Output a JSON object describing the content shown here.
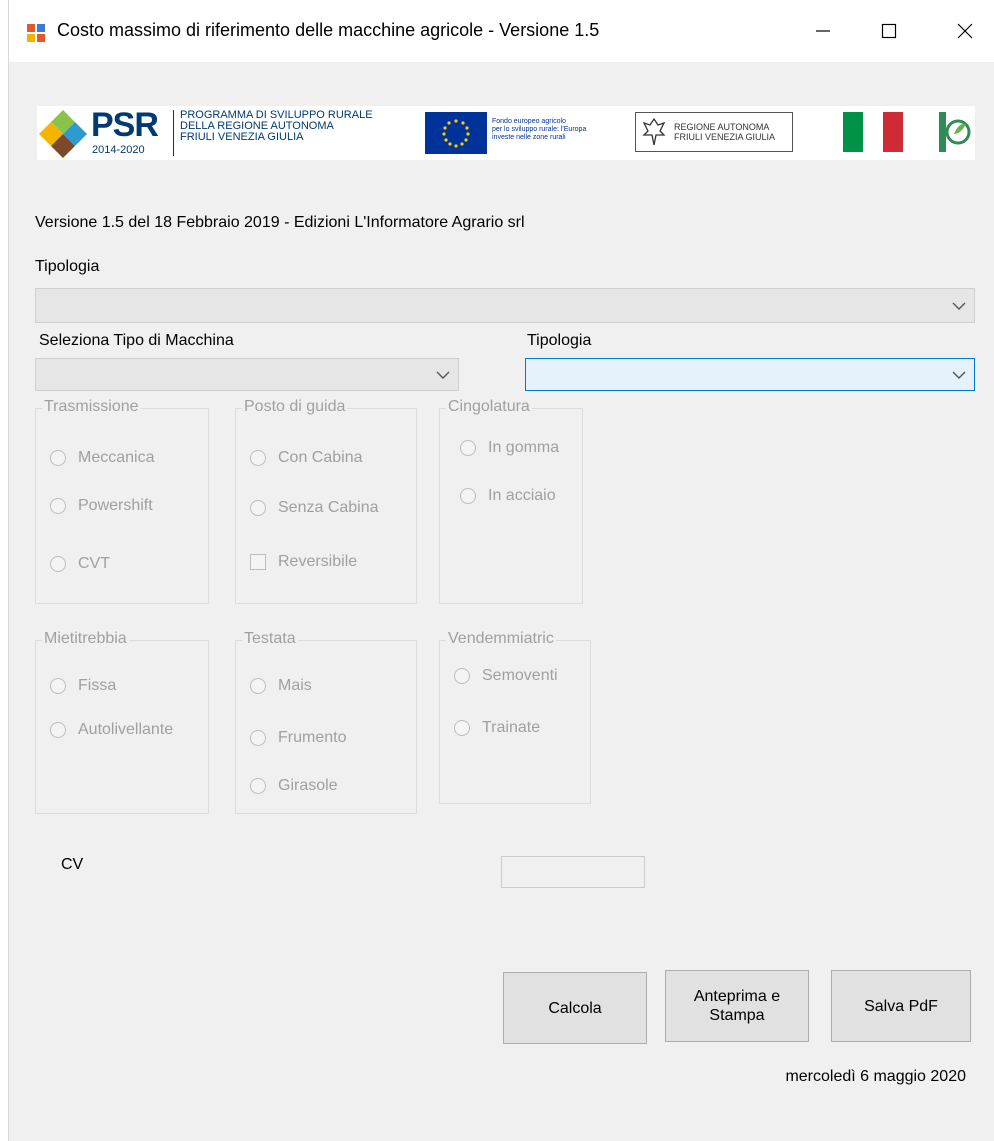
{
  "window": {
    "title": "Costo massimo di riferimento delle macchine agricole - Versione 1.5",
    "controls": [
      "minimize-icon",
      "maximize-icon",
      "close-icon"
    ]
  },
  "banner": {
    "psr": {
      "name": "PSR",
      "years": "2014-2020",
      "line1": "PROGRAMMA DI SVILUPPO RURALE",
      "line2": "DELLA REGIONE AUTONOMA",
      "line3": "FRIULI VENEZIA GIULIA"
    },
    "eu": {
      "line1": "Fondo europeo agricolo",
      "line2": "per lo sviluppo rurale: l'Europa",
      "line3": "investe nelle zone rurali"
    },
    "region": {
      "line1": "REGIONE AUTONOMA",
      "line2": "FRIULI VENEZIA GIULIA"
    },
    "colors": {
      "eu_blue": "#003399",
      "italy_green": "#009246",
      "italy_red": "#ce2b37"
    }
  },
  "version_text": "Versione 1.5 del 18 Febbraio 2019 - Edizioni L'Informatore Agrario srl",
  "tipologia_label": "Tipologia",
  "tipologia_value": "",
  "tipo_macchina_label": "Seleziona Tipo di Macchina",
  "tipo_macchina_value": "",
  "tipologia2_label": "Tipologia",
  "tipologia2_value": "",
  "groups": {
    "trasmissione": {
      "title": "Trasmissione",
      "options": [
        "Meccanica",
        "Powershift",
        "CVT"
      ]
    },
    "posto_guida": {
      "title": "Posto di guida",
      "options": [
        "Con Cabina",
        "Senza Cabina"
      ],
      "checkbox": "Reversibile"
    },
    "cingolatura": {
      "title": "Cingolatura",
      "options": [
        "In gomma",
        "In acciaio"
      ]
    },
    "mietitrebbia": {
      "title": "Mietitrebbia",
      "options": [
        "Fissa",
        "Autolivellante"
      ]
    },
    "testata": {
      "title": "Testata",
      "options": [
        "Mais",
        "Frumento",
        "Girasole"
      ]
    },
    "vendemmiatrice": {
      "title": "Vendemmiatric",
      "options": [
        "Semoventi",
        "Trainate"
      ]
    }
  },
  "cv_label": "CV",
  "cv_value": "",
  "buttons": {
    "calcola": "Calcola",
    "anteprima_line1": "Anteprima e",
    "anteprima_line2": "Stampa",
    "salva": "Salva PdF"
  },
  "date_text": "mercoledì 6 maggio 2020",
  "colors": {
    "accent": "#0078d7",
    "disabled_text": "#a0a0a0"
  }
}
